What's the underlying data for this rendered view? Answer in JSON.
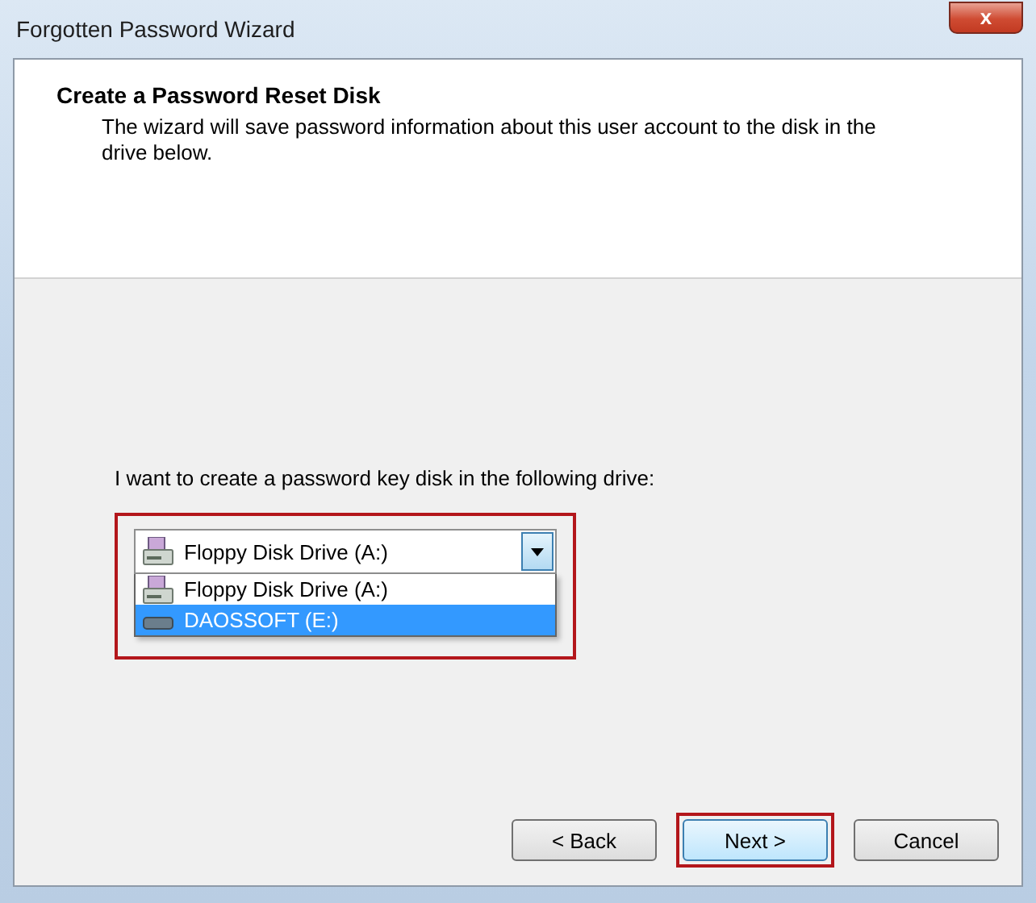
{
  "window": {
    "title": "Forgotten Password Wizard",
    "close_label": "x"
  },
  "header": {
    "title": "Create a Password Reset Disk",
    "description": "The wizard will save password information about this user account to the disk in the drive below."
  },
  "drive_prompt": "I want to create a password key disk in the following drive:",
  "drive_select": {
    "current": {
      "label": "Floppy Disk Drive (A:)",
      "kind": "floppy"
    },
    "expanded": true,
    "highlighted": true,
    "options": [
      {
        "label": "Floppy Disk Drive (A:)",
        "kind": "floppy",
        "selected": false
      },
      {
        "label": "DAOSSOFT (E:)",
        "kind": "removable",
        "selected": true
      }
    ]
  },
  "buttons": [
    {
      "label": "< Back",
      "default": false,
      "highlighted": false
    },
    {
      "label": "Next >",
      "default": true,
      "highlighted": true
    },
    {
      "label": "Cancel",
      "default": false,
      "highlighted": false
    }
  ]
}
